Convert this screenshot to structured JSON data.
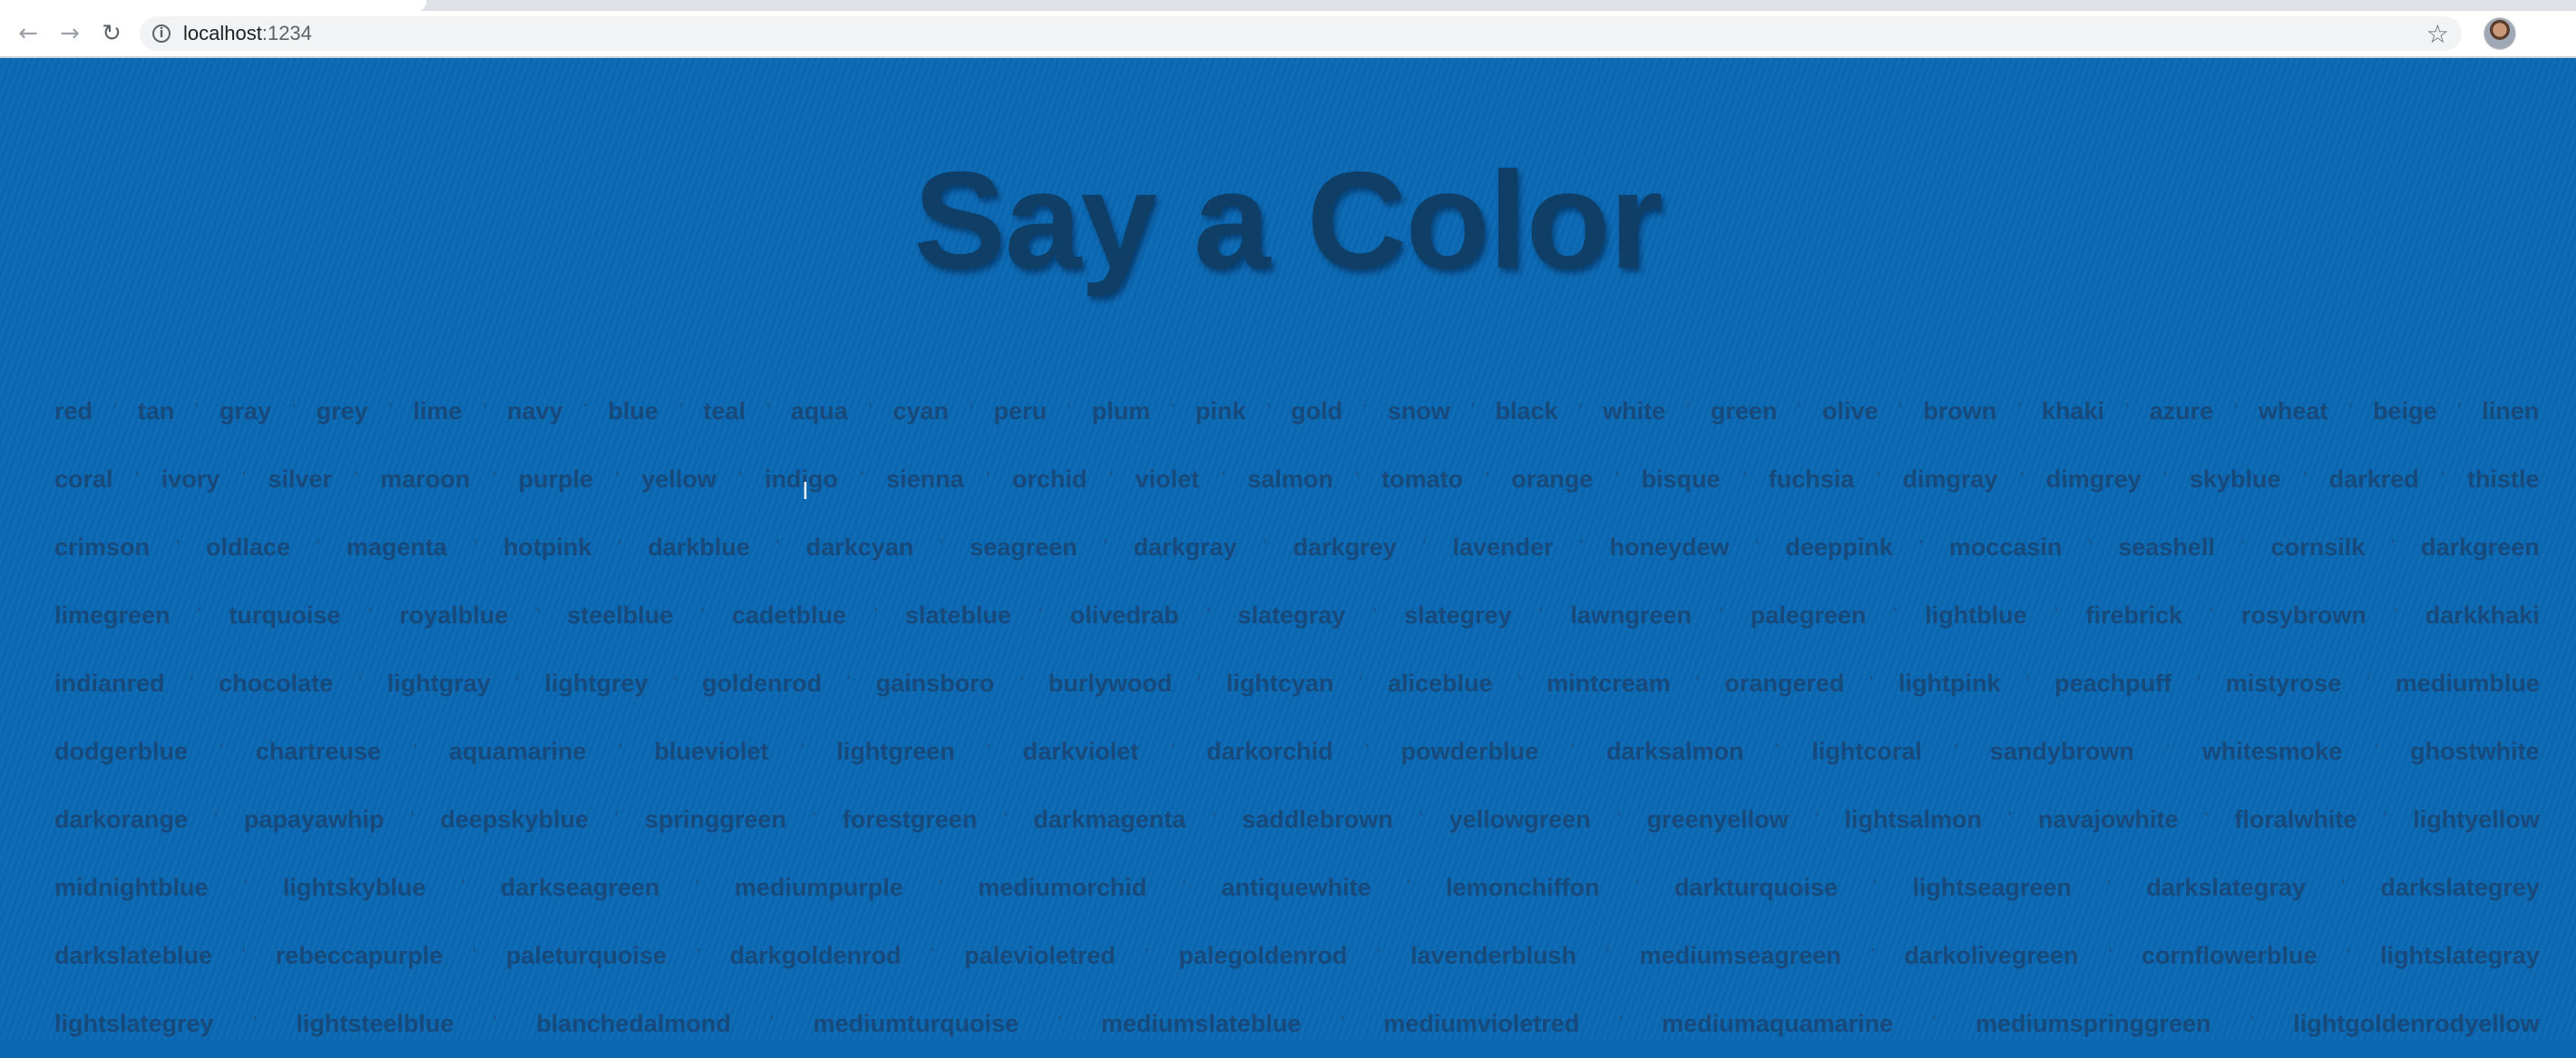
{
  "browser": {
    "back_icon": "arrow-left-icon",
    "forward_icon": "arrow-right-icon",
    "reload_icon": "reload-icon",
    "info_icon": "info-icon",
    "url_host": "localhost",
    "url_port": ":1234",
    "bookmark_icon": "star-icon"
  },
  "page": {
    "title": "Say a Color",
    "colors": [
      [
        "red",
        "tan",
        "gray",
        "grey",
        "lime",
        "navy",
        "blue",
        "teal",
        "aqua",
        "cyan",
        "peru",
        "plum",
        "pink",
        "gold",
        "snow",
        "black",
        "white",
        "green",
        "olive",
        "brown",
        "khaki",
        "azure",
        "wheat",
        "beige",
        "linen"
      ],
      [
        "coral",
        "ivory",
        "silver",
        "maroon",
        "purple",
        "yellow",
        "indigo",
        "sienna",
        "orchid",
        "violet",
        "salmon",
        "tomato",
        "orange",
        "bisque",
        "fuchsia",
        "dimgray",
        "dimgrey",
        "skyblue",
        "darkred",
        "thistle"
      ],
      [
        "crimson",
        "oldlace",
        "magenta",
        "hotpink",
        "darkblue",
        "darkcyan",
        "seagreen",
        "darkgray",
        "darkgrey",
        "lavender",
        "honeydew",
        "deeppink",
        "moccasin",
        "seashell",
        "cornsilk",
        "darkgreen"
      ],
      [
        "limegreen",
        "turquoise",
        "royalblue",
        "steelblue",
        "cadetblue",
        "slateblue",
        "olivedrab",
        "slategray",
        "slategrey",
        "lawngreen",
        "palegreen",
        "lightblue",
        "firebrick",
        "rosybrown",
        "darkkhaki"
      ],
      [
        "indianred",
        "chocolate",
        "lightgray",
        "lightgrey",
        "goldenrod",
        "gainsboro",
        "burlywood",
        "lightcyan",
        "aliceblue",
        "mintcream",
        "orangered",
        "lightpink",
        "peachpuff",
        "mistyrose",
        "mediumblue"
      ],
      [
        "dodgerblue",
        "chartreuse",
        "aquamarine",
        "blueviolet",
        "lightgreen",
        "darkviolet",
        "darkorchid",
        "powderblue",
        "darksalmon",
        "lightcoral",
        "sandybrown",
        "whitesmoke",
        "ghostwhite"
      ],
      [
        "darkorange",
        "papayawhip",
        "deepskyblue",
        "springgreen",
        "forestgreen",
        "darkmagenta",
        "saddlebrown",
        "yellowgreen",
        "greenyellow",
        "lightsalmon",
        "navajowhite",
        "floralwhite",
        "lightyellow"
      ],
      [
        "midnightblue",
        "lightskyblue",
        "darkseagreen",
        "mediumpurple",
        "mediumorchid",
        "antiquewhite",
        "lemonchiffon",
        "darkturquoise",
        "lightseagreen",
        "darkslategray",
        "darkslategrey"
      ],
      [
        "darkslateblue",
        "rebeccapurple",
        "paleturquoise",
        "darkgoldenrod",
        "palevioletred",
        "palegoldenrod",
        "lavenderblush",
        "mediumseagreen",
        "darkolivegreen",
        "cornflowerblue",
        "lightslategray"
      ],
      [
        "lightslategrey",
        "lightsteelblue",
        "blanchedalmond",
        "mediumturquoise",
        "mediumslateblue",
        "mediumvioletred",
        "mediumaquamarine",
        "mediumspringgreen",
        "lightgoldenrodyellow"
      ]
    ]
  }
}
